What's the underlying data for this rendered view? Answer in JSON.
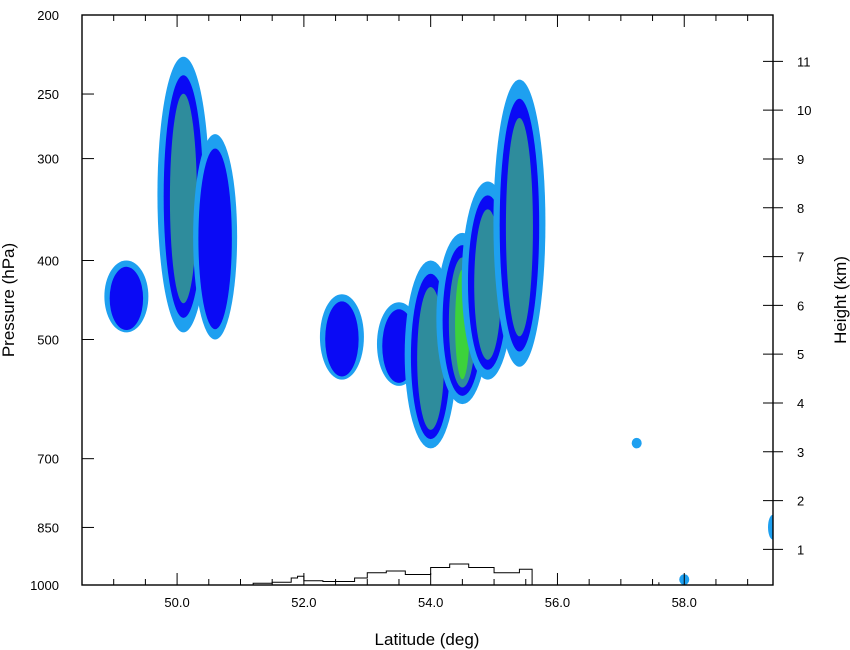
{
  "chart_data": {
    "type": "contour",
    "title": "",
    "xlabel": "Latitude (deg)",
    "ylabel_left": "Pressure (hPa)",
    "ylabel_right": "Height (km)",
    "xlim": [
      48.5,
      59.4
    ],
    "x_ticks": [
      {
        "value": 50.0,
        "label": "50.0"
      },
      {
        "value": 52.0,
        "label": "52.0"
      },
      {
        "value": 54.0,
        "label": "54.0"
      },
      {
        "value": 56.0,
        "label": "56.0"
      },
      {
        "value": 58.0,
        "label": "58.0"
      }
    ],
    "y_left_scale": "log",
    "y_left_range_hPa": [
      1000,
      200
    ],
    "y_left_ticks": [
      {
        "value": 200,
        "label": "200"
      },
      {
        "value": 250,
        "label": "250"
      },
      {
        "value": 300,
        "label": "300"
      },
      {
        "value": 400,
        "label": "400"
      },
      {
        "value": 500,
        "label": "500"
      },
      {
        "value": 700,
        "label": "700"
      },
      {
        "value": 850,
        "label": "850"
      },
      {
        "value": 1000,
        "label": "1000"
      }
    ],
    "y_right_ticks": [
      {
        "value": 1,
        "label": "1"
      },
      {
        "value": 2,
        "label": "2"
      },
      {
        "value": 3,
        "label": "3"
      },
      {
        "value": 4,
        "label": "4"
      },
      {
        "value": 5,
        "label": "5"
      },
      {
        "value": 6,
        "label": "6"
      },
      {
        "value": 7,
        "label": "7"
      },
      {
        "value": 8,
        "label": "8"
      },
      {
        "value": 9,
        "label": "9"
      },
      {
        "value": 10,
        "label": "10"
      },
      {
        "value": 11,
        "label": "11"
      }
    ],
    "contour_levels_colors": [
      "#1ea0f0",
      "#0a0af5",
      "#2e8c9c",
      "#3cd23c"
    ],
    "cells": [
      {
        "lat": 50.1,
        "p_top": 225,
        "p_bottom": 490,
        "peak_level": 3
      },
      {
        "lat": 49.2,
        "p_top": 400,
        "p_bottom": 490,
        "peak_level": 2
      },
      {
        "lat": 50.6,
        "p_top": 280,
        "p_bottom": 500,
        "peak_level": 2
      },
      {
        "lat": 52.6,
        "p_top": 440,
        "p_bottom": 560,
        "peak_level": 2
      },
      {
        "lat": 53.5,
        "p_top": 450,
        "p_bottom": 570,
        "peak_level": 2
      },
      {
        "lat": 54.0,
        "p_top": 400,
        "p_bottom": 680,
        "peak_level": 3
      },
      {
        "lat": 54.5,
        "p_top": 370,
        "p_bottom": 600,
        "peak_level": 4
      },
      {
        "lat": 54.9,
        "p_top": 320,
        "p_bottom": 560,
        "peak_level": 3
      },
      {
        "lat": 55.4,
        "p_top": 240,
        "p_bottom": 540,
        "peak_level": 3
      },
      {
        "lat": 57.25,
        "p_top": 660,
        "p_bottom": 680,
        "peak_level": 1
      },
      {
        "lat": 58.0,
        "p_top": 970,
        "p_bottom": 1000,
        "peak_level": 1
      },
      {
        "lat": 59.4,
        "p_top": 820,
        "p_bottom": 880,
        "peak_level": 1
      }
    ],
    "terrain": {
      "lat": [
        51.2,
        51.5,
        51.8,
        51.9,
        52.0,
        52.3,
        52.8,
        53.0,
        53.3,
        53.6,
        54.0,
        54.3,
        54.6,
        55.0,
        55.4,
        55.6,
        57.4,
        57.6
      ],
      "height_m": [
        50,
        80,
        200,
        250,
        120,
        100,
        200,
        350,
        400,
        300,
        500,
        600,
        500,
        350,
        450,
        0,
        0,
        80
      ]
    },
    "grid": false,
    "legend": "none"
  }
}
